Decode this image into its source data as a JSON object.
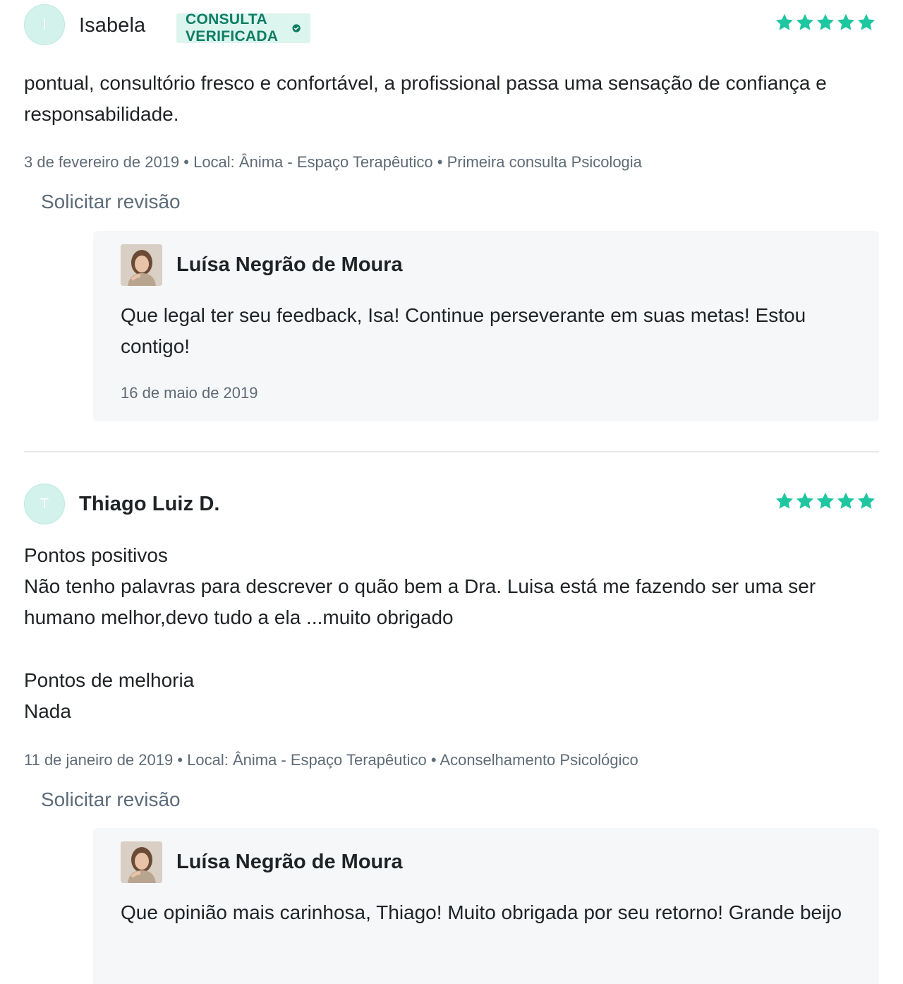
{
  "colors": {
    "accent": "#1ec7a0",
    "verified_bg": "#ddf5ef",
    "verified_text": "#0e7d64",
    "muted": "#5f6b76",
    "reply_bg": "#f6f7f9"
  },
  "reviews": [
    {
      "initial": "I",
      "name": "Isabela",
      "verified_label": "CONSULTA VERIFICADA",
      "rating": 5,
      "text": "pontual, consultório fresco e confortável, a profissional passa uma sensação de confiança e responsabilidade.",
      "meta": "3 de fevereiro de 2019 • Local: Ânima - Espaço Terapêutico • Primeira consulta Psicologia",
      "request_review": "Solicitar revisão",
      "reply": {
        "author": "Luísa Negrão de Moura",
        "text": "Que legal ter seu feedback, Isa! Continue perseverante em suas metas! Estou contigo!",
        "date": "16 de maio de 2019"
      }
    },
    {
      "initial": "T",
      "name": "Thiago Luiz D.",
      "rating": 5,
      "positive_title": "Pontos positivos",
      "positive_text": "Não tenho palavras para descrever o quão bem a Dra. Luisa está me fazendo ser uma ser humano melhor,devo tudo a ela ...muito obrigado",
      "improve_title": "Pontos de melhoria",
      "improve_text": "Nada",
      "meta": "11 de janeiro de 2019 • Local: Ânima - Espaço Terapêutico • Aconselhamento Psicológico",
      "request_review": "Solicitar revisão",
      "reply": {
        "author": "Luísa Negrão de Moura",
        "text": "Que opinião mais carinhosa, Thiago! Muito obrigada por seu retorno! Grande beijo"
      }
    }
  ]
}
